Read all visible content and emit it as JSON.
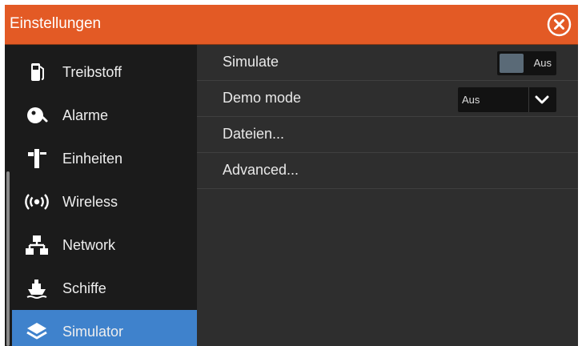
{
  "window": {
    "title": "Einstellungen"
  },
  "sidebar": {
    "items": [
      {
        "label": "Treibstoff",
        "icon": "fuel-pump-icon"
      },
      {
        "label": "Alarme",
        "icon": "alarm-bell-icon"
      },
      {
        "label": "Einheiten",
        "icon": "units-ruler-icon"
      },
      {
        "label": "Wireless",
        "icon": "wireless-icon"
      },
      {
        "label": "Network",
        "icon": "network-icon"
      },
      {
        "label": "Schiffe",
        "icon": "ship-icon"
      },
      {
        "label": "Simulator",
        "icon": "layers-icon",
        "selected": true
      }
    ]
  },
  "main": {
    "simulate": {
      "label": "Simulate",
      "state": "Aus"
    },
    "demo_mode": {
      "label": "Demo mode",
      "value": "Aus"
    },
    "files": {
      "label": "Dateien..."
    },
    "advanced": {
      "label": "Advanced..."
    }
  },
  "colors": {
    "titlebar": "#e35a25",
    "selected": "#3f82cc",
    "sidebar_bg": "#1b1b1b",
    "main_bg": "#2e2e2e"
  }
}
